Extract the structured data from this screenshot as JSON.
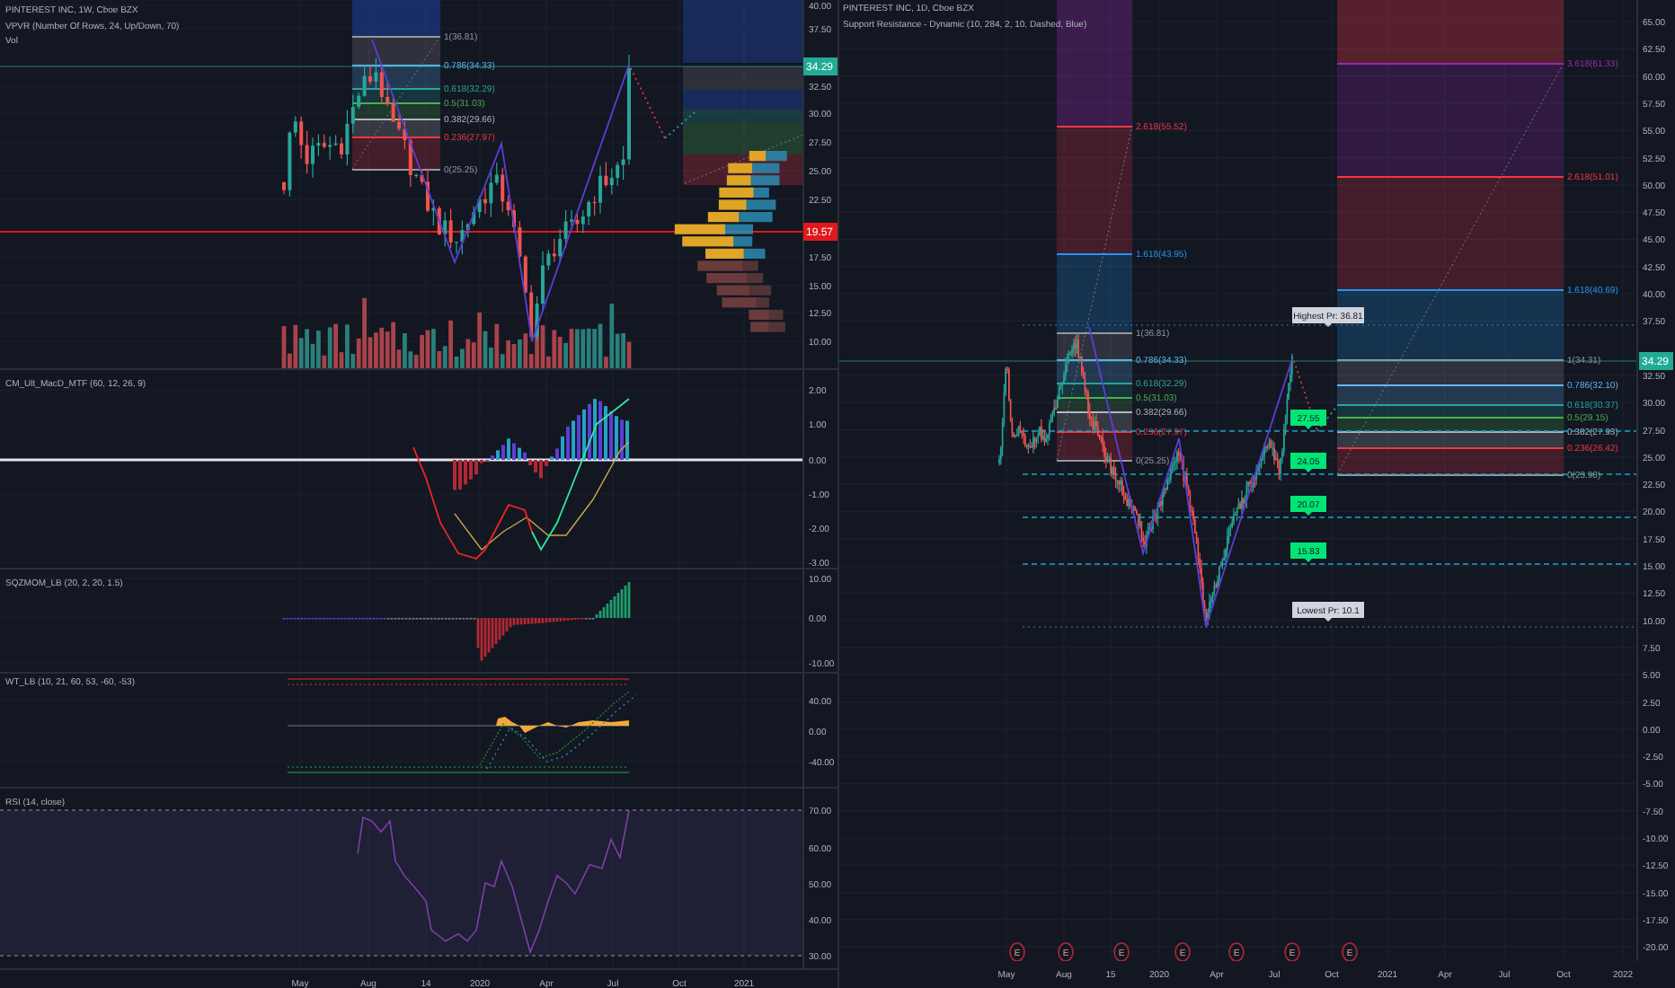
{
  "left_chart": {
    "main_pane": {
      "title": "PINTEREST INC, 1W, Cboe BZX",
      "indicators": [
        "VPVR (Number Of Rows, 24, Up/Down, 70)",
        "Vol"
      ],
      "fib_levels": [
        "1(36.81)",
        "0.786(34.33)",
        "0.618(32.29)",
        "0.5(31.03)",
        "0.382(29.66)",
        "0.236(27.97)",
        "0(25.25)"
      ],
      "price_axis": [
        "40.00",
        "37.50",
        "32.50",
        "30.00",
        "27.50",
        "25.00",
        "22.50",
        "17.50",
        "15.00",
        "12.50",
        "10.00"
      ],
      "price_badges": [
        {
          "kind": "last_price",
          "text": "34.29"
        },
        {
          "kind": "level",
          "text": "19.57"
        }
      ]
    },
    "indicator_panes": [
      {
        "kind": "macd",
        "title": "CM_Ult_MacD_MTF (60, 12, 26, 9)",
        "axis": [
          "2.00",
          "1.00",
          "0.00",
          "-1.00",
          "-2.00",
          "-3.00"
        ]
      },
      {
        "kind": "squeeze",
        "title": "SQZMOM_LB (20, 2, 20, 1.5)",
        "axis": [
          "10.00",
          "0.00",
          "-10.00"
        ]
      },
      {
        "kind": "wavetrend",
        "title": "WT_LB (10, 21, 60, 53, -60, -53)",
        "axis": [
          "40.00",
          "0.00",
          "-40.00"
        ]
      },
      {
        "kind": "rsi",
        "title": "RSI (14, close)",
        "axis": [
          "70.00",
          "60.00",
          "50.00",
          "40.00",
          "30.00"
        ]
      }
    ],
    "time_axis": [
      "May",
      "Aug",
      "14",
      "2020",
      "Apr",
      "Jul",
      "Oct",
      "2021"
    ]
  },
  "right_chart": {
    "title": "PINTEREST INC, 1D, Cboe BZX",
    "indicators": [
      "Support Resistance - Dynamic (10, 284, 2, 10, Dashed, Blue)"
    ],
    "fib_retracements": [
      {
        "levels": [
          "2.618(55.52)",
          "1.618(43.95)",
          "1(36.81)",
          "0.786(34.33)",
          "0.618(32.29)",
          "0.5(31.03)",
          "0.382(29.66)",
          "0.236(27.97)",
          "0(25.25)"
        ]
      },
      {
        "levels": [
          "3.618(61.33)",
          "2.618(51.01)",
          "1.618(40.69)",
          "1(34.31)",
          "0.786(32.10)",
          "0.618(30.37)",
          "0.5(29.15)",
          "0.382(27.93)",
          "0.236(26.42)",
          "0(23.98)"
        ]
      }
    ],
    "support_levels": [
      "27.55",
      "24.05",
      "20.07",
      "15.83"
    ],
    "extreme_tags": [
      "Highest Pr: 36.81",
      "Lowest Pr: 10.1"
    ],
    "price_axis": [
      "65.00",
      "62.50",
      "60.00",
      "57.50",
      "55.00",
      "52.50",
      "50.00",
      "47.50",
      "45.00",
      "42.50",
      "40.00",
      "37.50",
      "32.50",
      "30.00",
      "27.50",
      "25.00",
      "22.50",
      "20.00",
      "17.50",
      "15.00",
      "12.50",
      "10.00",
      "7.50",
      "5.00",
      "2.50",
      "0.00",
      "-2.50",
      "-5.00",
      "-7.50",
      "-10.00",
      "-12.50",
      "-15.00",
      "-17.50",
      "-20.00"
    ],
    "price_badges": [
      {
        "kind": "last_price",
        "text": "34.29"
      }
    ],
    "earnings_markers": [
      "E",
      "E",
      "E",
      "E",
      "E",
      "E",
      "E"
    ],
    "time_axis": [
      "May",
      "Aug",
      "15",
      "2020",
      "Apr",
      "Jul",
      "Oct",
      "2021",
      "Apr",
      "Jul",
      "Oct",
      "2022"
    ]
  }
}
